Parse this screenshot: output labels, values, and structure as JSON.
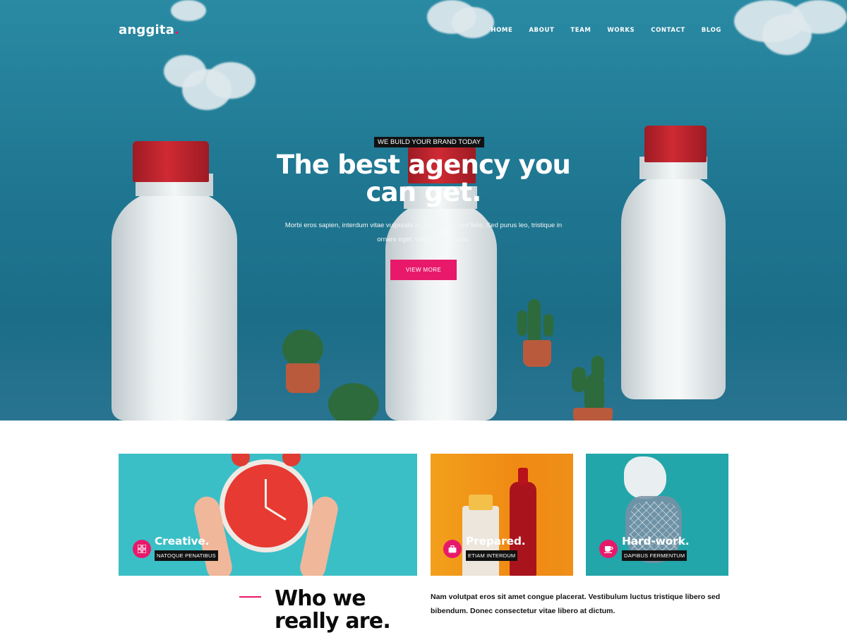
{
  "brand": {
    "name": "anggita",
    "dot": "."
  },
  "nav": {
    "items": [
      "HOME",
      "ABOUT",
      "TEAM",
      "WORKS",
      "CONTACT",
      "BLOG"
    ]
  },
  "hero": {
    "tagline": "WE BUILD YOUR BRAND TODAY",
    "title_line1": "The best agency you",
    "title_line2": "can get.",
    "description": "Morbi eros sapien, interdum vitae vulputate in, vestibulum sed felis. Sed purus leo, tristique in ornare eget, volutpat et mauris.",
    "button_label": "VIEW MORE"
  },
  "cards": [
    {
      "title": "Creative.",
      "label": "NATOQUE PENATIBUS",
      "icon": "grid-icon"
    },
    {
      "title": "Prepared.",
      "label": "ETIAM INTERDUM",
      "icon": "briefcase-icon"
    },
    {
      "title": "Hard-work.",
      "label": "DAPIBUS FERMENTUM",
      "icon": "coffee-cup-icon"
    }
  ],
  "about": {
    "title_line1": "Who we",
    "title_line2": "really are.",
    "text": "Nam volutpat eros sit amet congue placerat. Vestibulum luctus tristique libero sed bibendum. Donec consectetur vitae libero at dictum."
  },
  "colors": {
    "accent": "#e8196b",
    "hero_blue": "#1f7691",
    "label_bg": "#111111"
  }
}
